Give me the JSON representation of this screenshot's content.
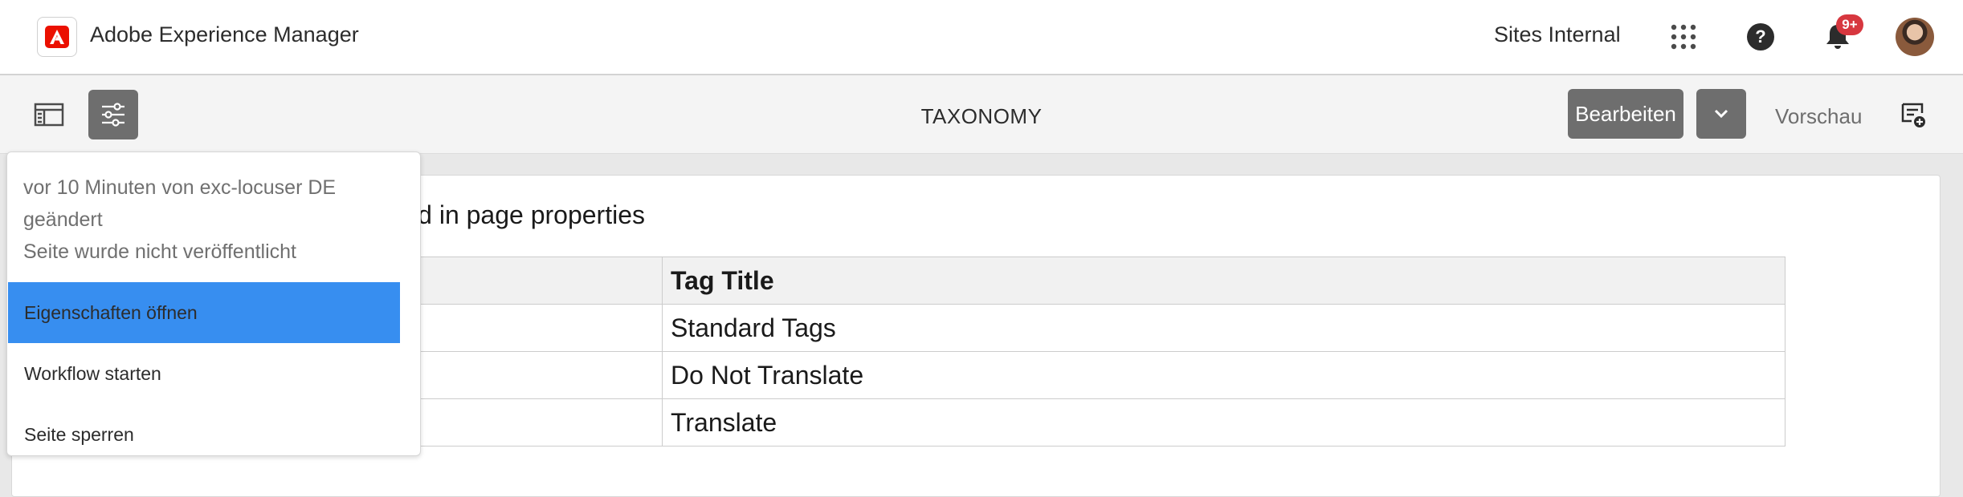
{
  "shell": {
    "app_title": "Adobe Experience Manager",
    "org_name": "Sites Internal",
    "notification_count": "9+",
    "brand_color": "#eb1000",
    "icons": [
      "adobe-logo-icon",
      "apps-grid-icon",
      "help-icon",
      "bell-icon",
      "avatar"
    ]
  },
  "toolbar": {
    "page_title": "TAXONOMY",
    "edit_label": "Bearbeiten",
    "preview_label": "Vorschau",
    "icons": [
      "side-panel-icon",
      "page-info-icon",
      "chevron-down-icon",
      "annotations-icon"
    ]
  },
  "content": {
    "heading_visible": "d in page properties",
    "table": {
      "headers": [
        "",
        "Tag Title"
      ],
      "rows": [
        [
          "",
          "Standard Tags"
        ],
        [
          "",
          "Do Not Translate"
        ],
        [
          "",
          "Translate"
        ]
      ]
    }
  },
  "page_info": {
    "modified_line1": "vor 10 Minuten von exc-locuser DE",
    "modified_line2": "geändert",
    "publish_status": "Seite wurde nicht veröffentlicht",
    "items": [
      {
        "label": "Eigenschaften öffnen",
        "active": true
      },
      {
        "label": "Workflow starten",
        "active": false
      },
      {
        "label": "Seite sperren",
        "active": false
      }
    ],
    "active_color": "#378ef0"
  }
}
